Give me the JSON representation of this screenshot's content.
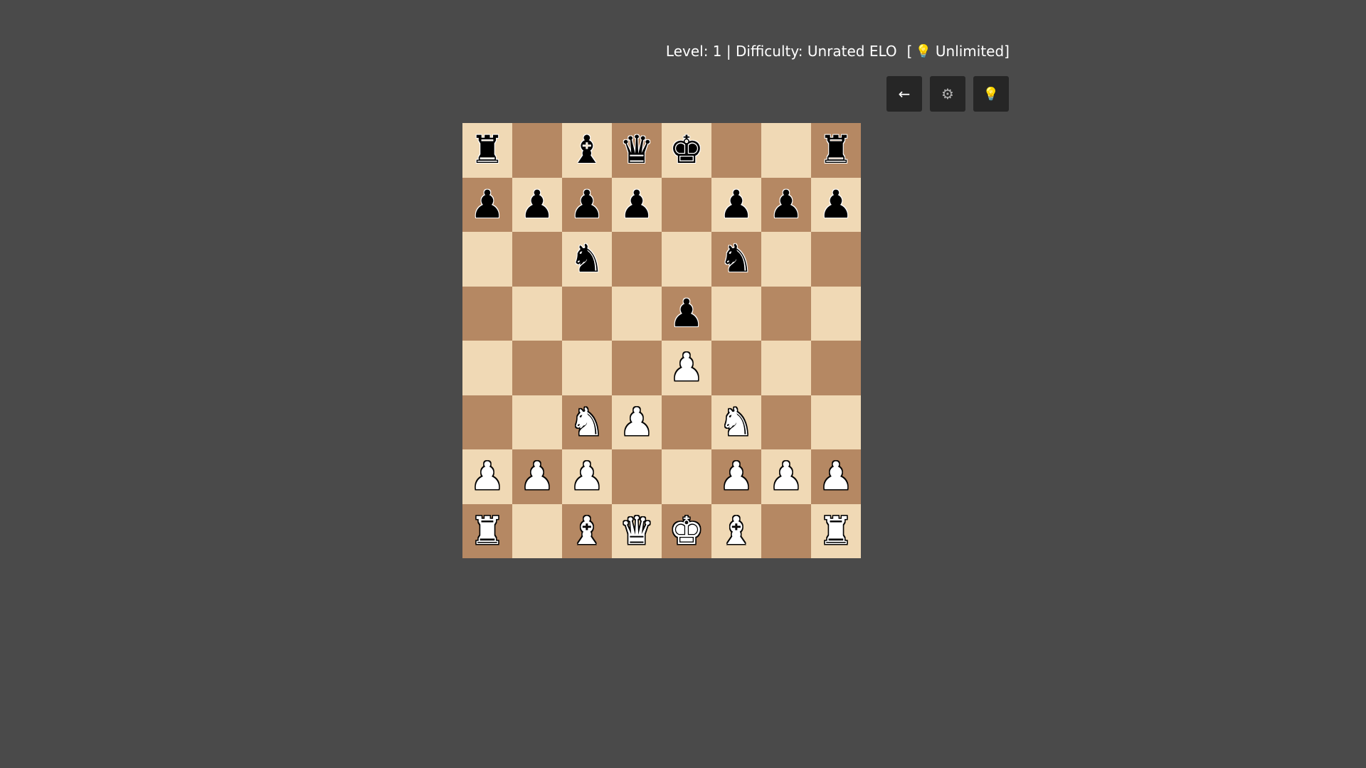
{
  "status": {
    "level_text": "Level: 1 | Difficulty: Unrated ELO",
    "hint_open": "[",
    "hint_icon": "💡",
    "hint_text": "Unlimited]"
  },
  "controls": [
    {
      "name": "back-button",
      "icon": "back-arrow-icon",
      "glyph": "←"
    },
    {
      "name": "settings-button",
      "icon": "gear-icon",
      "glyph": "⚙"
    },
    {
      "name": "hint-button",
      "icon": "lightbulb-icon",
      "glyph": "💡"
    }
  ],
  "colors": {
    "background": "#4a4a4a",
    "light_square": "#f0d9b5",
    "dark_square": "#b58863",
    "button": "#262626",
    "bulb": "#f2c21b"
  },
  "board": {
    "ranks": [
      [
        "bR",
        "",
        "bB",
        "bQ",
        "bK",
        "",
        "",
        "bR"
      ],
      [
        "bP",
        "bP",
        "bP",
        "bP",
        "",
        "bP",
        "bP",
        "bP"
      ],
      [
        "",
        "",
        "bN",
        "",
        "",
        "bN",
        "",
        ""
      ],
      [
        "",
        "",
        "",
        "",
        "bP",
        "",
        "",
        ""
      ],
      [
        "",
        "",
        "",
        "",
        "wP",
        "",
        "",
        ""
      ],
      [
        "",
        "",
        "wN",
        "wP",
        "",
        "wN",
        "",
        ""
      ],
      [
        "wP",
        "wP",
        "wP",
        "",
        "",
        "wP",
        "wP",
        "wP"
      ],
      [
        "wR",
        "",
        "wB",
        "wQ",
        "wK",
        "wB",
        "",
        "wR"
      ]
    ],
    "top_left_square": "light"
  }
}
